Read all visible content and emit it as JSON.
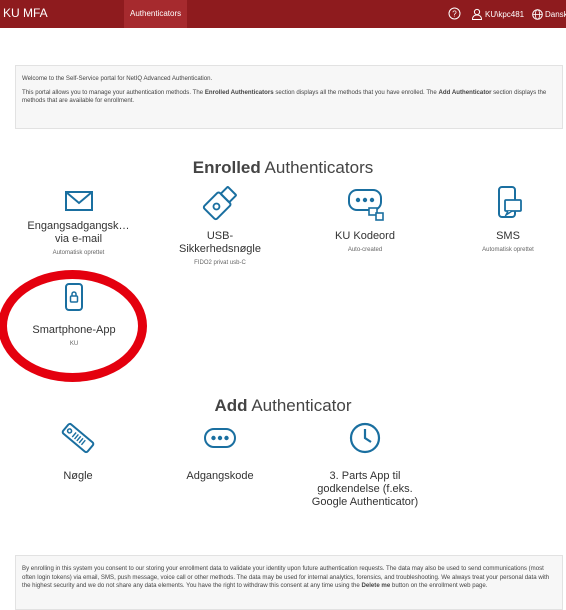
{
  "header": {
    "brand": "KU MFA",
    "nav_tab": "Authenticators",
    "user": "KU\\kpc481",
    "language": "Dansk"
  },
  "welcome": {
    "line1": "Welcome to the Self-Service portal for NetIQ Advanced Authentication.",
    "line2_a": "This portal allows you to manage your authentication methods. The ",
    "line2_b": "Enrolled Authenticators",
    "line2_c": " section displays all the methods that you have enrolled. The ",
    "line2_d": "Add Authenticator",
    "line2_e": " section displays the methods that are available for enrollment."
  },
  "enrolled": {
    "title_bold": "Enrolled",
    "title_rest": " Authenticators",
    "items": [
      {
        "name": "Engangsadgangsk…\nvia e-mail",
        "sub": "Automatisk oprettet",
        "icon": "envelope-icon"
      },
      {
        "name": "USB-\nSikkerhedsnøgle",
        "sub": "FIDO2 privat usb-C",
        "icon": "usb-key-icon"
      },
      {
        "name": "KU Kodeord",
        "sub": "Auto-created",
        "icon": "password-icon"
      },
      {
        "name": "SMS",
        "sub": "Automatisk oprettet",
        "icon": "sms-phone-icon"
      },
      {
        "name": "Smartphone-App",
        "sub": "KU",
        "icon": "smartphone-lock-icon"
      }
    ]
  },
  "add": {
    "title_bold": "Add",
    "title_rest": " Authenticator",
    "items": [
      {
        "name": "Nøgle",
        "icon": "key-tag-icon"
      },
      {
        "name": "Adgangskode",
        "icon": "password-bubble-icon"
      },
      {
        "name": "3. Parts App til\ngodkendelse (f.eks.\nGoogle Authenticator)",
        "icon": "clock-icon"
      }
    ]
  },
  "consent": {
    "text_a": "By enrolling in this system you consent to our storing your enrollment data to validate your identity upon future authentication requests. The data may also be used to send communications (most often login tokens) via email, SMS, push message, voice call or other methods. The data may be used for internal analytics, forensics, and troubleshooting. We always treat your personal data with the highest security and we do not share any data elements. You have the right to withdraw this consent at any time using the ",
    "delete_label": "Delete me",
    "text_b": " button on the enrollment web page."
  },
  "colors": {
    "header_bg": "#8e1b1e",
    "accent": "#1a6fa0",
    "annotation_circle": "#e4000e"
  }
}
